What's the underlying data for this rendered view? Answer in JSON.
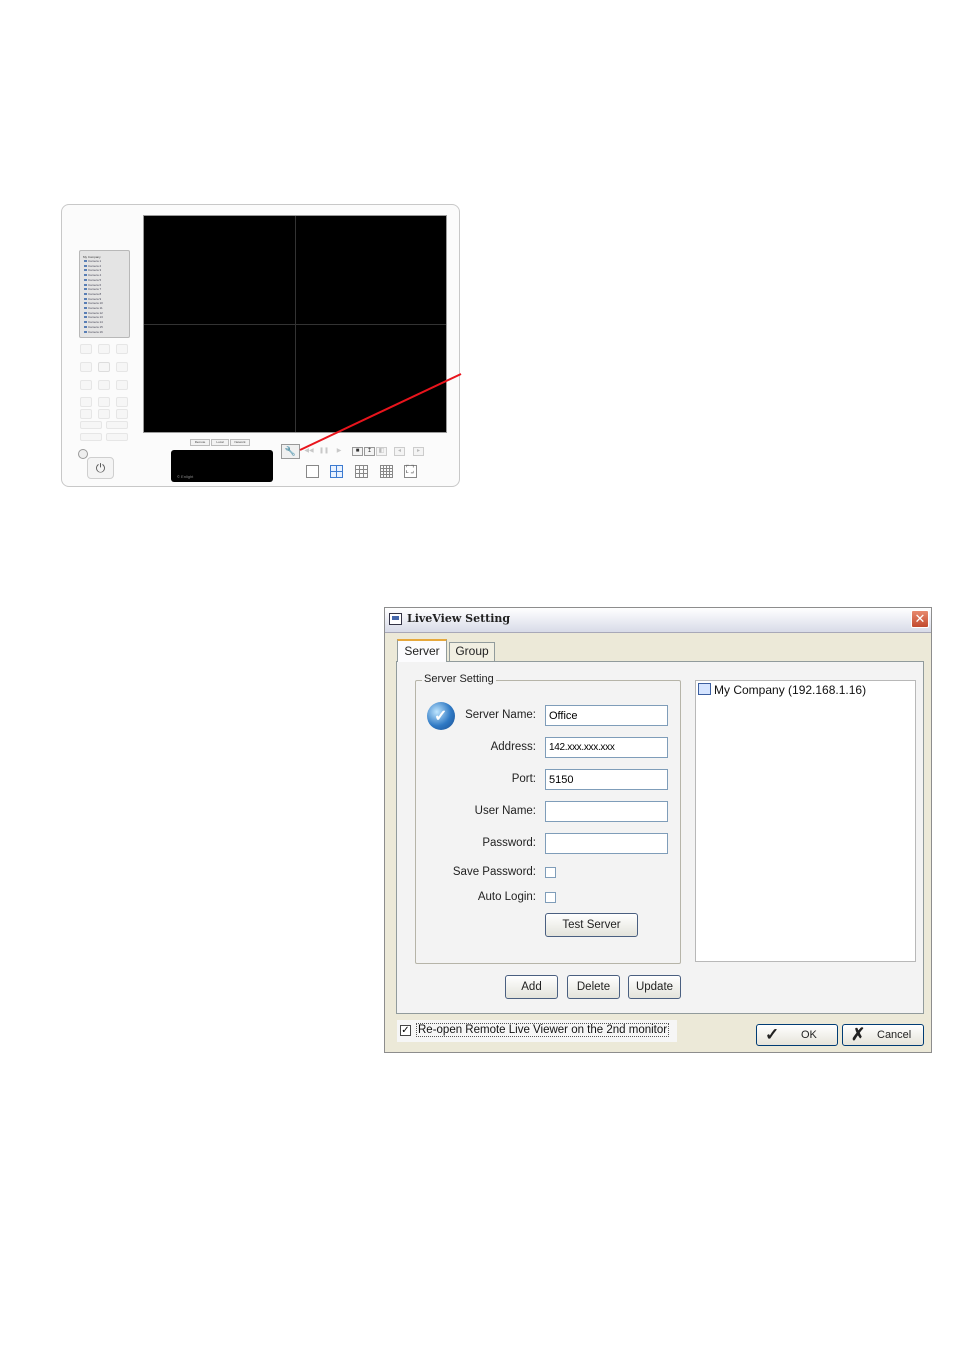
{
  "viewer": {
    "tree_root": "My Company",
    "cameras": [
      "Camera 1",
      "Camera 2",
      "Camera 3",
      "Camera 4",
      "Camera 5",
      "Camera 6",
      "Camera 7",
      "Camera 8",
      "Camera 9",
      "Camera 10",
      "Camera 11",
      "Camera 12",
      "Camera 13",
      "Camera 14",
      "Camera 15",
      "Camera 16"
    ],
    "tiny_buttons": [
      "Remote",
      "Local",
      "Network"
    ],
    "brand": "© Enlight",
    "power_glyph": "⏻",
    "setting_glyph": "🔧"
  },
  "dialog": {
    "title": "LiveView Setting",
    "close_glyph": "✕",
    "tabs": [
      "Server",
      "Group"
    ],
    "group_title": "Server Setting",
    "fields": {
      "server_name_label": "Server Name:",
      "server_name_value": "Office",
      "address_label": "Address:",
      "address_value": "142.xxx.xxx.xxx",
      "port_label": "Port:",
      "port_value": "5150",
      "user_name_label": "User Name:",
      "user_name_value": "",
      "password_label": "Password:",
      "password_value": "",
      "save_password_label": "Save Password:",
      "auto_login_label": "Auto Login:"
    },
    "test_server": "Test Server",
    "actions": {
      "add": "Add",
      "delete": "Delete",
      "update": "Update"
    },
    "server_list": [
      "My Company (192.168.1.16)"
    ],
    "reopen_label": "Re-open Remote Live Viewer on the 2nd monitor",
    "reopen_checked_glyph": "✓",
    "ok": "OK",
    "ok_glyph": "✓",
    "cancel": "Cancel",
    "cancel_glyph": "✗"
  },
  "colors": {
    "pointer": "#e8141c",
    "tab_highlight": "#e6a83c",
    "close_button": "#c24a2e"
  }
}
